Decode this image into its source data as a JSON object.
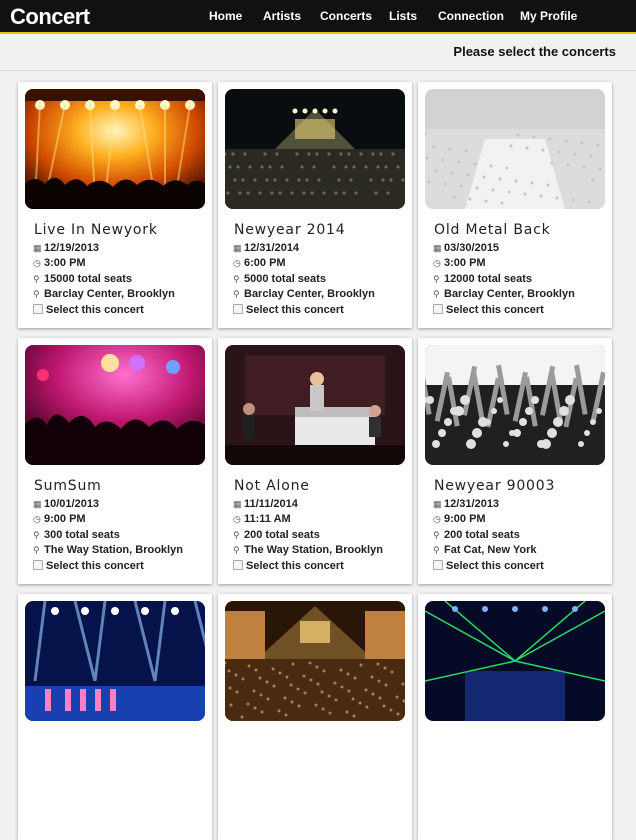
{
  "app": {
    "brand": "Concert"
  },
  "nav": [
    {
      "label": "Home"
    },
    {
      "label": "Artists"
    },
    {
      "label": "Concerts"
    },
    {
      "label": "Lists"
    },
    {
      "label": "Connection"
    },
    {
      "label": "My Profile"
    }
  ],
  "subheader": {
    "text": "Please select the concerts"
  },
  "concerts": [
    {
      "title": "Live In Newyork",
      "date": "12/19/2013",
      "time": "3:00 PM",
      "seats": "15000 total seats",
      "venue": "Barclay Center, Brooklyn",
      "select_label": "Select this concert",
      "photo": "orange-stage-lights"
    },
    {
      "title": "Newyear 2014",
      "date": "12/31/2014",
      "time": "6:00 PM",
      "seats": "5000 total seats",
      "venue": "Barclay Center, Brooklyn",
      "select_label": "Select this concert",
      "photo": "arena-crowd"
    },
    {
      "title": "Old Metal Back",
      "date": "03/30/2015",
      "time": "3:00 PM",
      "seats": "12000 total seats",
      "venue": "Barclay Center, Brooklyn",
      "select_label": "Select this concert",
      "photo": "faded-arena"
    },
    {
      "title": "SumSum",
      "date": "10/01/2013",
      "time": "9:00 PM",
      "seats": "300 total seats",
      "venue": "The Way Station, Brooklyn",
      "select_label": "Select this concert",
      "photo": "pink-lights-crowd"
    },
    {
      "title": "Not Alone",
      "date": "11/11/2014",
      "time": "11:11 AM",
      "seats": "200 total seats",
      "venue": "The Way Station, Brooklyn",
      "select_label": "Select this concert",
      "photo": "piano-singer"
    },
    {
      "title": "Newyear 90003",
      "date": "12/31/2013",
      "time": "9:00 PM",
      "seats": "200 total seats",
      "venue": "Fat Cat, New York",
      "select_label": "Select this concert",
      "photo": "bw-hands-crowd"
    },
    {
      "title": "",
      "date": "",
      "time": "",
      "seats": "",
      "venue": "",
      "select_label": "",
      "photo": "blue-stage-performers"
    },
    {
      "title": "",
      "date": "",
      "time": "",
      "seats": "",
      "venue": "",
      "select_label": "",
      "photo": "theater-crowd"
    },
    {
      "title": "",
      "date": "",
      "time": "",
      "seats": "",
      "venue": "",
      "select_label": "",
      "photo": "green-lasers"
    }
  ]
}
